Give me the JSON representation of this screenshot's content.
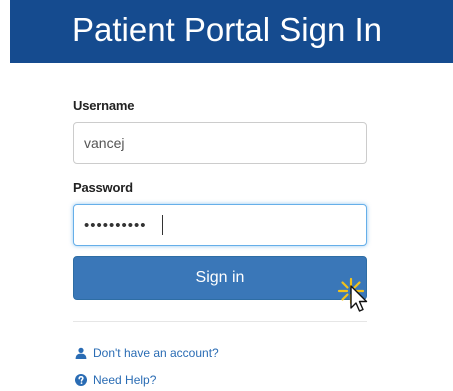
{
  "header": {
    "title": "Patient Portal Sign In"
  },
  "form": {
    "username_label": "Username",
    "username_value": "vancej",
    "password_label": "Password",
    "password_masked": "••••••••••",
    "submit_label": "Sign in"
  },
  "links": {
    "no_account": "Don't have an account?",
    "need_help": "Need Help?"
  },
  "icons": {
    "no_account": "user-icon",
    "need_help": "question-circle-icon",
    "pointer": "mouse-pointer-icon"
  },
  "colors": {
    "banner": "#154b8f",
    "primary_button": "#3a77b8",
    "link": "#2a6cb4",
    "focus_border": "#66afe9",
    "cursor_highlight": "#f2c21b"
  }
}
